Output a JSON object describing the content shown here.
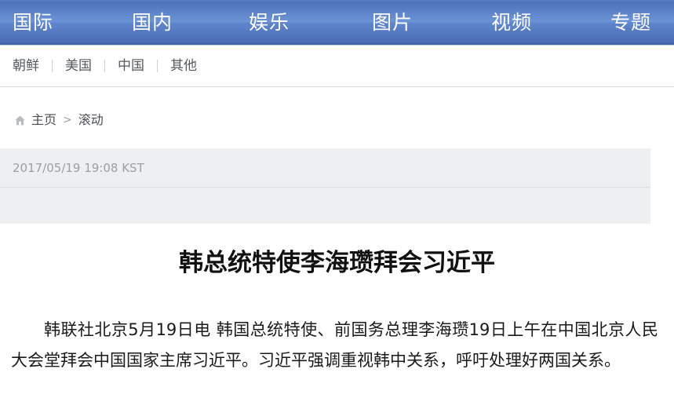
{
  "primary_nav": {
    "items": [
      {
        "label": "国际"
      },
      {
        "label": "国内"
      },
      {
        "label": "娱乐"
      },
      {
        "label": "图片"
      },
      {
        "label": "视频"
      },
      {
        "label": "专题"
      }
    ]
  },
  "secondary_nav": {
    "items": [
      {
        "label": "朝鲜"
      },
      {
        "label": "美国"
      },
      {
        "label": "中国"
      },
      {
        "label": "其他"
      }
    ]
  },
  "breadcrumb": {
    "home_icon": "home-icon",
    "home_label": "主页",
    "separator": ">",
    "current_label": "滚动"
  },
  "article": {
    "timestamp": "2017/05/19 19:08 KST",
    "headline": "韩总统特使李海瓒拜会习近平",
    "body": "韩联社北京5月19日电 韩国总统特使、前国务总理李海瓒19日上午在中国北京人民大会堂拜会中国国家主席习近平。习近平强调重视韩中关系，呼吁处理好两国关系。"
  },
  "colors": {
    "nav_blue_top": "#5c80c4",
    "nav_blue_mid": "#6c93d6",
    "nav_blue_bottom": "#3f60a8",
    "meta_box_bg": "#eeeff1",
    "meta_text": "#9b9fa4",
    "sub_nav_text": "#555a5f",
    "body_text": "#1a1a1a"
  }
}
